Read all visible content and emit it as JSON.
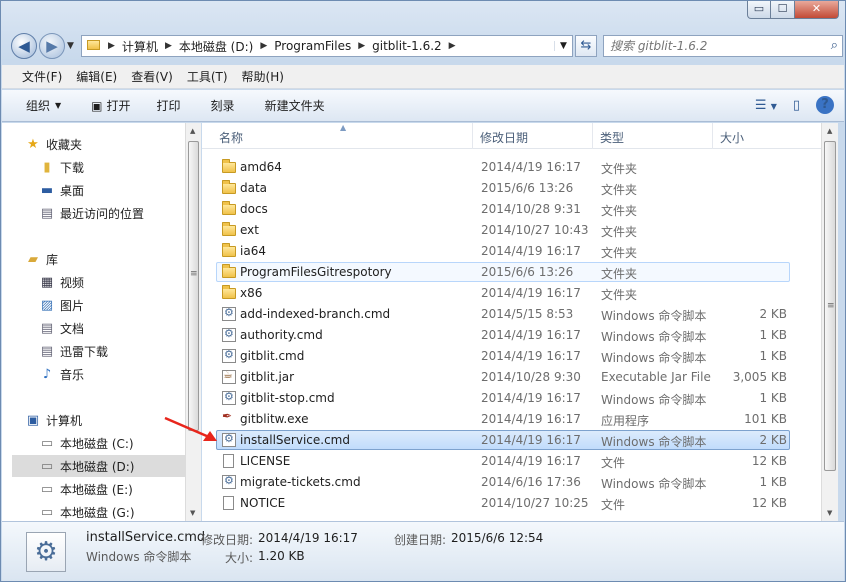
{
  "window": {
    "caption": {
      "minimize": "▭",
      "maximize": "☐",
      "close": "✕"
    }
  },
  "nav": {
    "back": "◀",
    "forward": "▶",
    "breadcrumbs": [
      "计算机",
      "本地磁盘 (D:)",
      "ProgramFiles",
      "gitblit-1.6.2"
    ],
    "search_placeholder": "搜索 gitblit-1.6.2"
  },
  "menu": [
    "文件(F)",
    "编辑(E)",
    "查看(V)",
    "工具(T)",
    "帮助(H)"
  ],
  "toolbar": {
    "organize": "组织",
    "open": "打开",
    "print": "打印",
    "burn": "刻录",
    "new_folder": "新建文件夹"
  },
  "sidebar": {
    "favorites": "收藏夹",
    "downloads": "下载",
    "desktop": "桌面",
    "recent": "最近访问的位置",
    "libraries": "库",
    "videos": "视频",
    "pictures": "图片",
    "documents": "文档",
    "xunlei": "迅雷下载",
    "music": "音乐",
    "computer": "计算机",
    "drive_c": "本地磁盘 (C:)",
    "drive_d": "本地磁盘 (D:)",
    "drive_e": "本地磁盘 (E:)",
    "drive_g": "本地磁盘 (G:)"
  },
  "columns": {
    "name": "名称",
    "date": "修改日期",
    "type": "类型",
    "size": "大小"
  },
  "files": [
    {
      "name": "amd64",
      "date": "2014/4/19 16:17",
      "type": "文件夹",
      "size": "",
      "icon": "folder-icon"
    },
    {
      "name": "data",
      "date": "2015/6/6 13:26",
      "type": "文件夹",
      "size": "",
      "icon": "folder-icon"
    },
    {
      "name": "docs",
      "date": "2014/10/28 9:31",
      "type": "文件夹",
      "size": "",
      "icon": "folder-icon"
    },
    {
      "name": "ext",
      "date": "2014/10/27 10:43",
      "type": "文件夹",
      "size": "",
      "icon": "folder-icon"
    },
    {
      "name": "ia64",
      "date": "2014/4/19 16:17",
      "type": "文件夹",
      "size": "",
      "icon": "folder-icon"
    },
    {
      "name": "ProgramFilesGitrespotory",
      "date": "2015/6/6 13:26",
      "type": "文件夹",
      "size": "",
      "icon": "folder-icon"
    },
    {
      "name": "x86",
      "date": "2014/4/19 16:17",
      "type": "文件夹",
      "size": "",
      "icon": "folder-icon"
    },
    {
      "name": "add-indexed-branch.cmd",
      "date": "2014/5/15 8:53",
      "type": "Windows 命令脚本",
      "size": "2 KB",
      "icon": "cmd-file-icon"
    },
    {
      "name": "authority.cmd",
      "date": "2014/4/19 16:17",
      "type": "Windows 命令脚本",
      "size": "1 KB",
      "icon": "cmd-file-icon"
    },
    {
      "name": "gitblit.cmd",
      "date": "2014/4/19 16:17",
      "type": "Windows 命令脚本",
      "size": "1 KB",
      "icon": "cmd-file-icon"
    },
    {
      "name": "gitblit.jar",
      "date": "2014/10/28 9:30",
      "type": "Executable Jar File",
      "size": "3,005 KB",
      "icon": "jar-file-icon"
    },
    {
      "name": "gitblit-stop.cmd",
      "date": "2014/4/19 16:17",
      "type": "Windows 命令脚本",
      "size": "1 KB",
      "icon": "cmd-file-icon"
    },
    {
      "name": "gitblitw.exe",
      "date": "2014/4/19 16:17",
      "type": "应用程序",
      "size": "101 KB",
      "icon": "exe-file-icon"
    },
    {
      "name": "installService.cmd",
      "date": "2014/4/19 16:17",
      "type": "Windows 命令脚本",
      "size": "2 KB",
      "icon": "cmd-file-icon"
    },
    {
      "name": "LICENSE",
      "date": "2014/4/19 16:17",
      "type": "文件",
      "size": "12 KB",
      "icon": "document-icon"
    },
    {
      "name": "migrate-tickets.cmd",
      "date": "2014/6/16 17:36",
      "type": "Windows 命令脚本",
      "size": "1 KB",
      "icon": "cmd-file-icon"
    },
    {
      "name": "NOTICE",
      "date": "2014/10/27 10:25",
      "type": "文件",
      "size": "12 KB",
      "icon": "document-icon"
    }
  ],
  "details": {
    "name": "installService.cmd",
    "type": "Windows 命令脚本",
    "modified_label": "修改日期:",
    "modified": "2014/4/19 16:17",
    "created_label": "创建日期:",
    "created": "2015/6/6 12:54",
    "size_label": "大小:",
    "size": "1.20 KB"
  },
  "colors": {
    "accent_red_arrow": "#e8261c",
    "selection": "#c1dcfc"
  }
}
